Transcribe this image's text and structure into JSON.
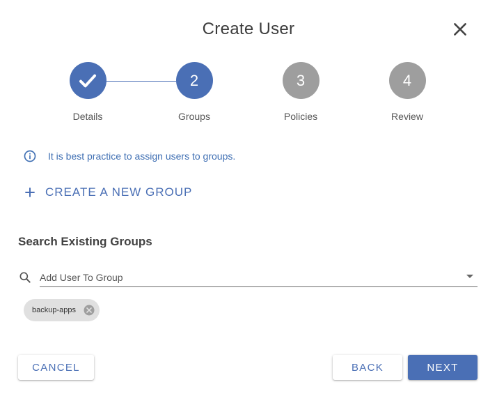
{
  "dialog": {
    "title": "Create User"
  },
  "stepper": {
    "steps": [
      {
        "number": "1",
        "label": "Details",
        "state": "completed"
      },
      {
        "number": "2",
        "label": "Groups",
        "state": "active"
      },
      {
        "number": "3",
        "label": "Policies",
        "state": "inactive"
      },
      {
        "number": "4",
        "label": "Review",
        "state": "inactive"
      }
    ]
  },
  "info": {
    "text": "It is best practice to assign users to groups."
  },
  "create_group": {
    "label": "CREATE A NEW GROUP"
  },
  "search_groups": {
    "title": "Search Existing Groups",
    "placeholder": "Add User To Group",
    "value": ""
  },
  "selected_groups": [
    {
      "label": "backup-apps"
    }
  ],
  "buttons": {
    "cancel": "CANCEL",
    "back": "BACK",
    "next": "NEXT"
  },
  "colors": {
    "primary": "#4a6fb5",
    "inactive_step": "#9e9e9e",
    "info_text": "#3f6fb3",
    "chip_bg": "#e0e0e0"
  },
  "icons": {
    "close": "close-icon",
    "check": "check-icon",
    "info": "info-icon",
    "plus": "plus-icon",
    "search": "search-icon",
    "dropdown": "chevron-down-icon",
    "chip_remove": "cancel-circle-icon"
  }
}
